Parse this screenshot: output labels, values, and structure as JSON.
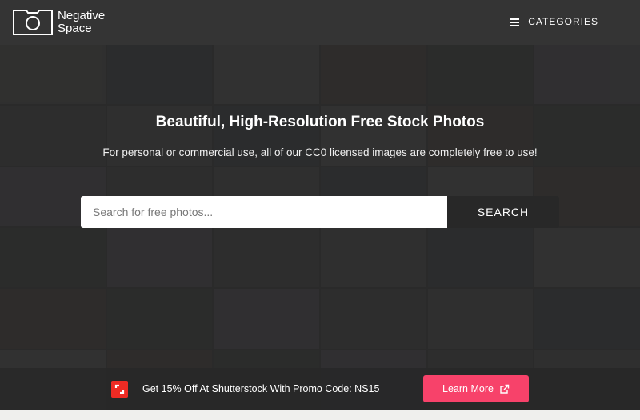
{
  "header": {
    "logo_line1": "Negative",
    "logo_line2": "Space",
    "categories_label": "CATEGORIES",
    "menu_icon": "hamburger-icon"
  },
  "hero": {
    "title": "Beautiful, High-Resolution Free Stock Photos",
    "subtitle": "For personal or commercial use, all of our CC0 licensed images are completely free to use!"
  },
  "search": {
    "placeholder": "Search for free photos...",
    "value": "",
    "button_label": "SEARCH"
  },
  "promo": {
    "icon": "shutterstock-icon",
    "text": "Get 15% Off At Shutterstock With Promo Code: NS15",
    "button_label": "Learn More",
    "button_icon": "external-link-icon"
  },
  "colors": {
    "header_bg": "#343434",
    "accent": "#f7426a",
    "shutterstock": "#ee2b24",
    "search_button_bg": "#282828"
  }
}
